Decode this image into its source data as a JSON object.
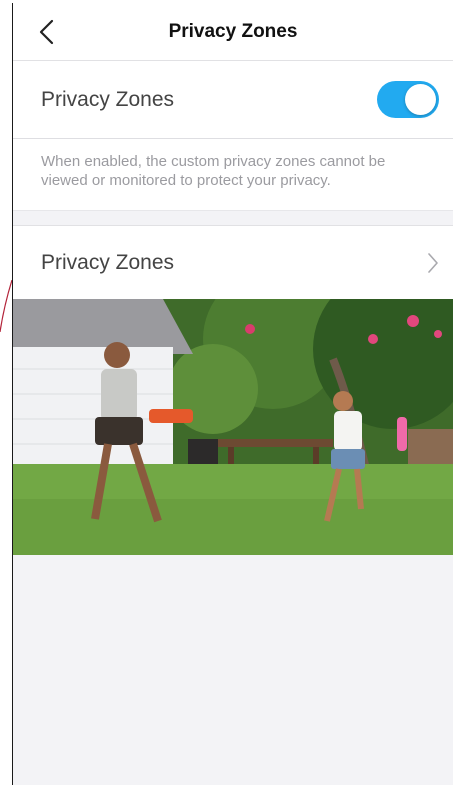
{
  "nav": {
    "title": "Privacy Zones",
    "back_icon": "chevron-left-icon"
  },
  "toggle_row": {
    "label": "Privacy Zones",
    "enabled": true,
    "accent_color": "#22aaf0"
  },
  "description": "When enabled, the custom privacy zones cannot be viewed or monitored to protect your privacy.",
  "zones_row": {
    "label": "Privacy Zones",
    "chevron_icon": "chevron-right-icon"
  },
  "camera_preview": {
    "description_icon": "camera-feed-image"
  }
}
